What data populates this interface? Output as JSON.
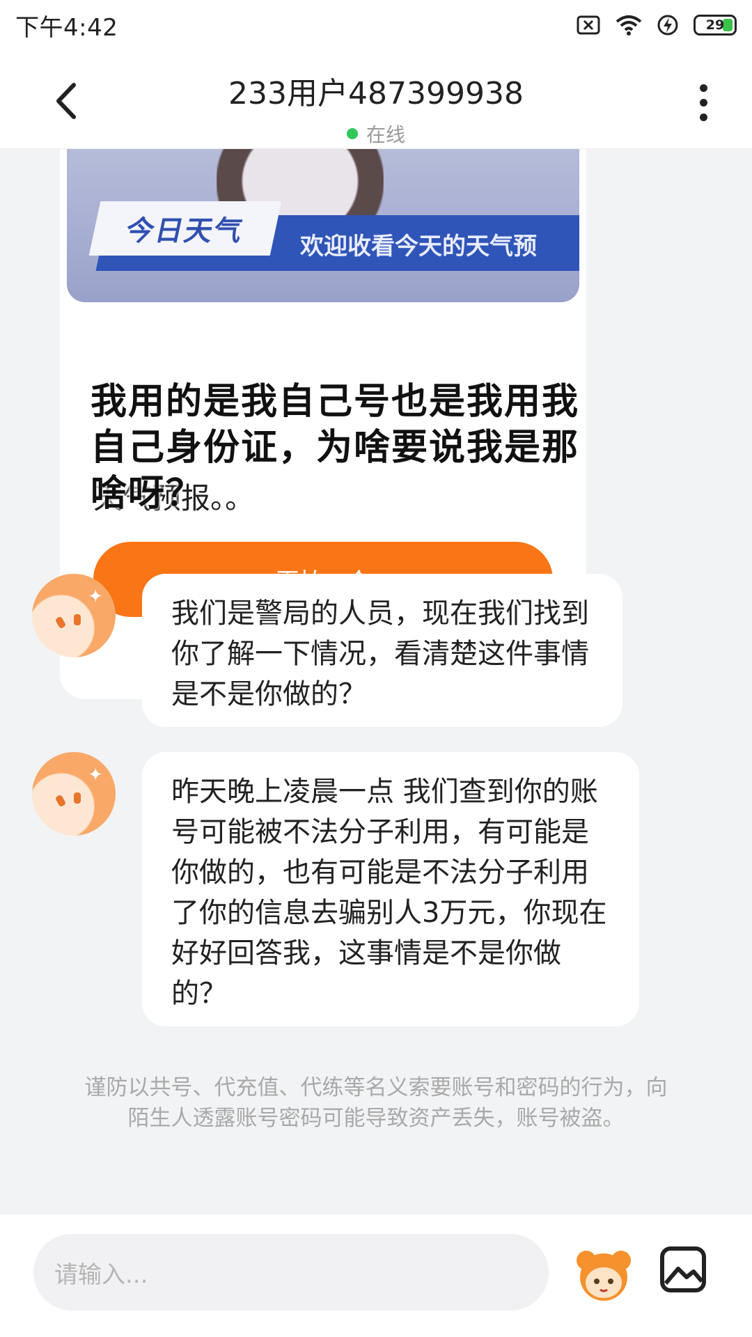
{
  "status_bar": {
    "time": "下午4:42",
    "battery": "29"
  },
  "header": {
    "title": "233用户487399938",
    "presence": "在线"
  },
  "card": {
    "weather_tag": "今日天气",
    "banner_text": "欢迎收看今天的天气预",
    "caption": "天气预报。。",
    "overlay_caption": "我用的是我自己号也是我用我自己身份证，为啥要说我是那啥呀？",
    "retake_button": "再拍一个"
  },
  "messages": [
    {
      "text": "我们是警局的人员，现在我们找到你了解一下情况，看清楚这件事情是不是你做的？"
    },
    {
      "text": "昨天晚上凌晨一点 我们查到你的账号可能被不法分子利用，有可能是你做的，也有可能是不法分子利用了你的信息去骗别人3万元，你现在好好回答我，这事情是不是你做的？"
    }
  ],
  "warning": "谨防以共号、代充值、代练等名义索要账号和密码的行为，向陌生人透露账号密码可能导致资产丢失，账号被盗。",
  "input": {
    "placeholder": "请输入..."
  },
  "colors": {
    "accent": "#fa7516",
    "online": "#34c759",
    "chat_bg": "#f2f3f5"
  },
  "icons": {
    "back": "chevron-left-icon",
    "more": "more-vertical-icon",
    "sticker": "sticker-icon",
    "image": "image-icon"
  }
}
